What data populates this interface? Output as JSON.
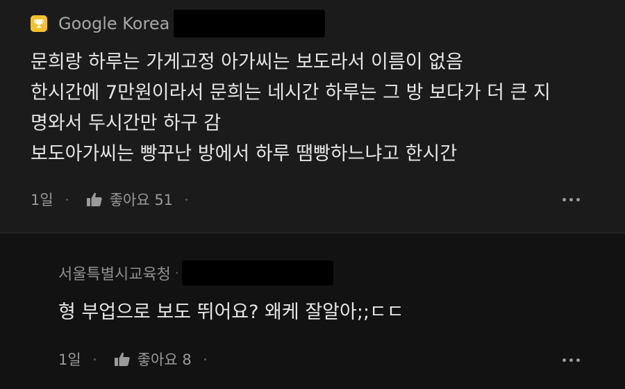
{
  "colors": {
    "background": "#1b1b1b",
    "reply_background": "#121212",
    "badge": "#f4c12e",
    "text": "#e6e6e6",
    "meta_text": "#9a9a9a"
  },
  "main_comment": {
    "badge_icon": "trophy-icon",
    "author": "Google Korea",
    "lines": [
      "문희랑 하루는 가게고정 아가씨는 보도라서 이름이 없음",
      "한시간에 7만원이라서 문희는 네시간 하루는 그 방 보다가 더 큰 지",
      "명와서 두시간만 하구 감",
      "보도아가씨는 빵꾸난 방에서 하루 땜빵하느냐고 한시간"
    ],
    "time": "1일",
    "like_icon": "thumbs-up-icon",
    "like_label": "좋아요 51",
    "more_icon": "more-horizontal-icon"
  },
  "reply_comment": {
    "author": "서울특별시교육청",
    "separator": "·",
    "body": "형 부업으로 보도 뛰어요? 왜케 잘알아;;ㄷㄷ",
    "time": "1일",
    "like_icon": "thumbs-up-icon",
    "like_label": "좋아요 8",
    "more_icon": "more-horizontal-icon"
  }
}
